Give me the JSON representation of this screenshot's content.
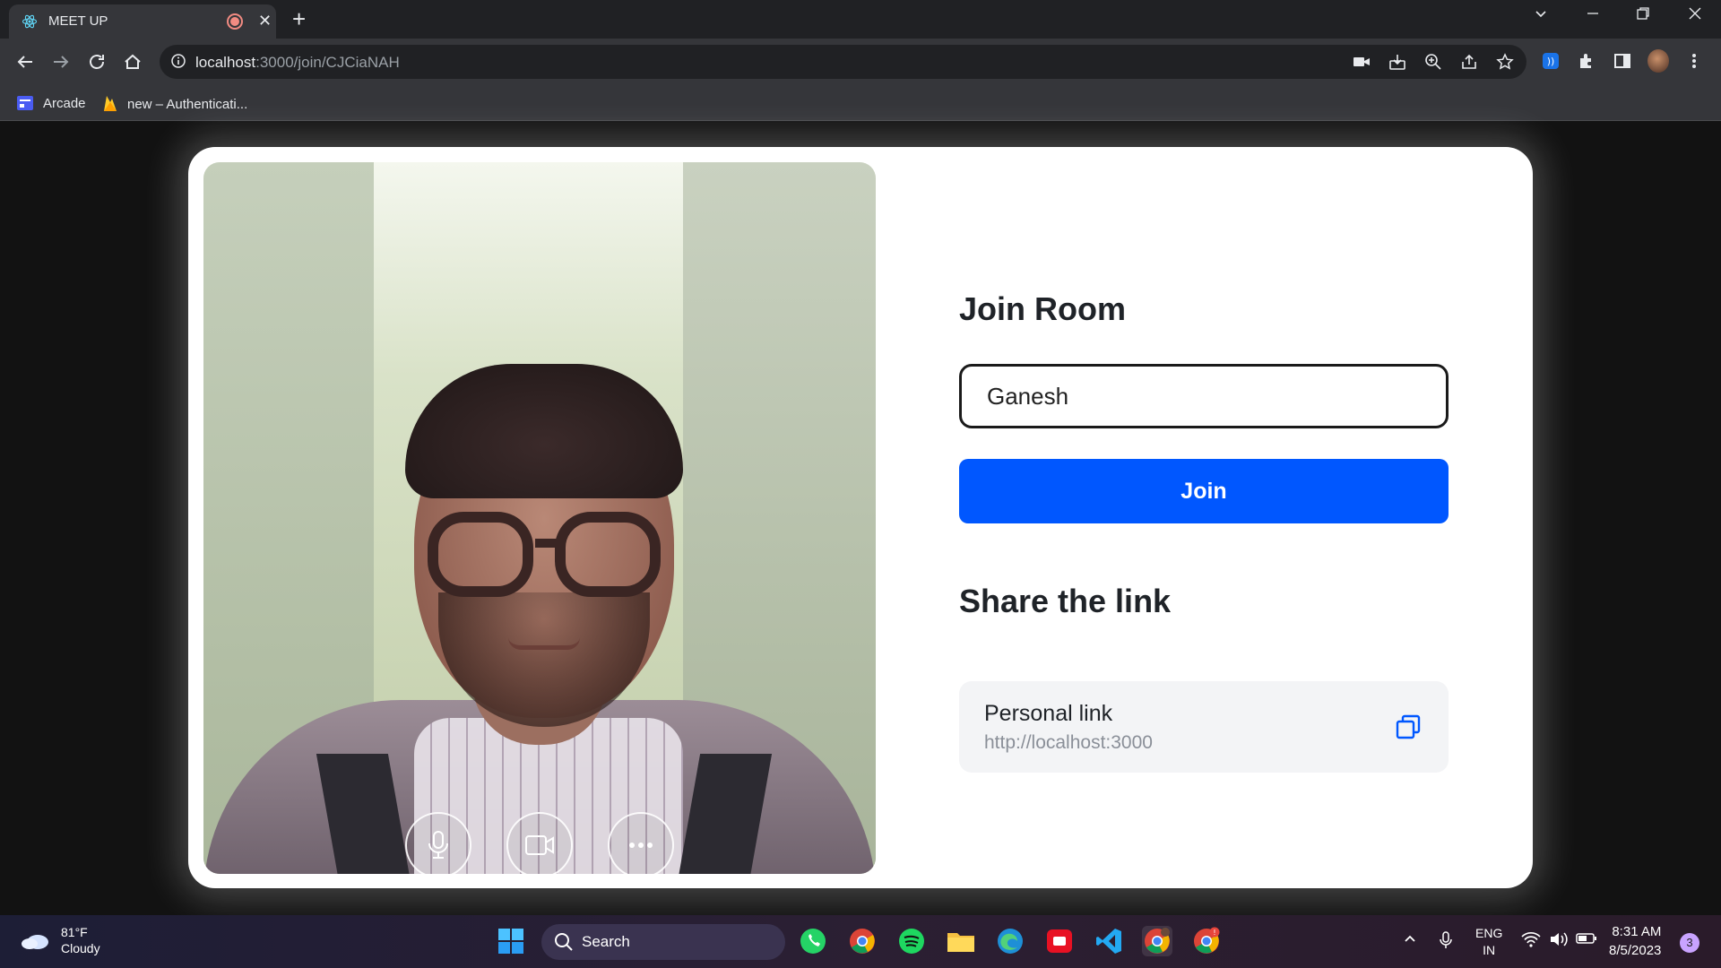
{
  "browser": {
    "tab_title": "MEET UP",
    "tab_close": "✕",
    "new_tab": "+",
    "url_host": "localhost",
    "url_path": ":3000/join/CJCiaNAH",
    "bookmarks": [
      {
        "label": "Arcade"
      },
      {
        "label": "new – Authenticati..."
      }
    ]
  },
  "page": {
    "join_title": "Join Room",
    "name_value": "Ganesh",
    "join_button": "Join",
    "share_title": "Share the link",
    "personal_link_label": "Personal link",
    "personal_link_url": "http://localhost:3000"
  },
  "video_controls": [
    "mic-icon",
    "camera-icon",
    "more-icon"
  ],
  "taskbar": {
    "weather_temp": "81°F",
    "weather_desc": "Cloudy",
    "search_label": "Search",
    "lang_top": "ENG",
    "lang_bottom": "IN",
    "time": "8:31 AM",
    "date": "8/5/2023",
    "notifications": "3",
    "chrome_badge": "!"
  },
  "colors": {
    "accent": "#0057ff",
    "chrome_bg": "#202124",
    "toolbar_bg": "#35363a"
  }
}
